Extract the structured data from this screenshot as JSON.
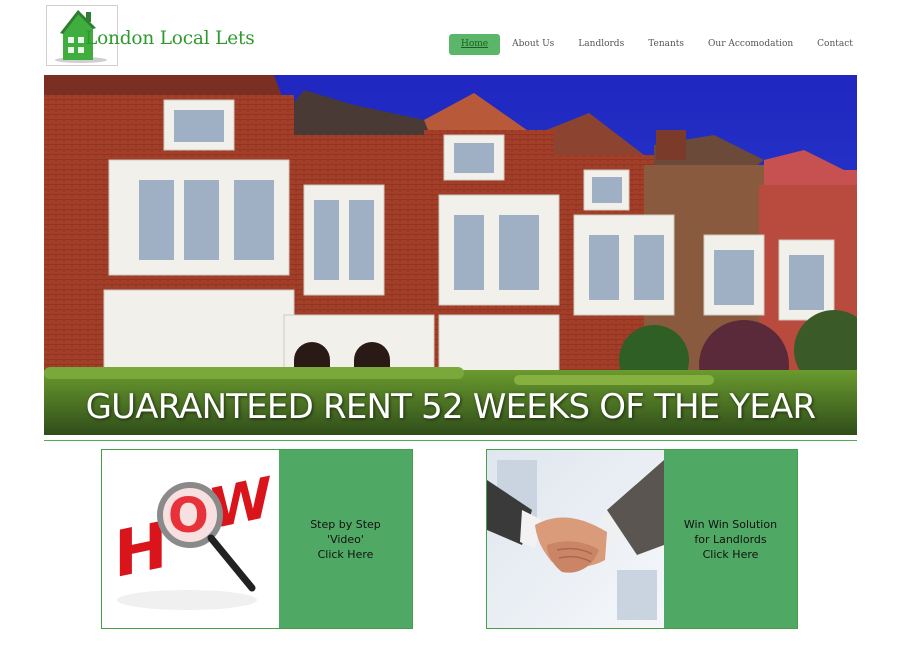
{
  "header": {
    "brand_name": "London Local Lets",
    "logo_icon": "house-icon"
  },
  "nav": {
    "items": [
      {
        "label": "Home",
        "active": true
      },
      {
        "label": "About Us",
        "active": false
      },
      {
        "label": "Landlords",
        "active": false
      },
      {
        "label": "Tenants",
        "active": false
      },
      {
        "label": "Our Accomodation",
        "active": false
      },
      {
        "label": "Contact",
        "active": false
      }
    ]
  },
  "hero": {
    "caption": "GUARANTEED RENT 52 WEEKS OF THE YEAR",
    "image": "terraced-houses-photo"
  },
  "promos": [
    {
      "text": "Step by Step\n'Video'\nClick Here",
      "image": "how-magnifier-image"
    },
    {
      "text": "Win Win Solution\nfor Landlords\nClick Here",
      "image": "handshake-image"
    }
  ],
  "colors": {
    "accent_green": "#4fa965",
    "brand_green": "#2e9a2e",
    "nav_active": "#5bb66a",
    "sky_blue": "#2130c8",
    "brick": "#9c3b28"
  }
}
